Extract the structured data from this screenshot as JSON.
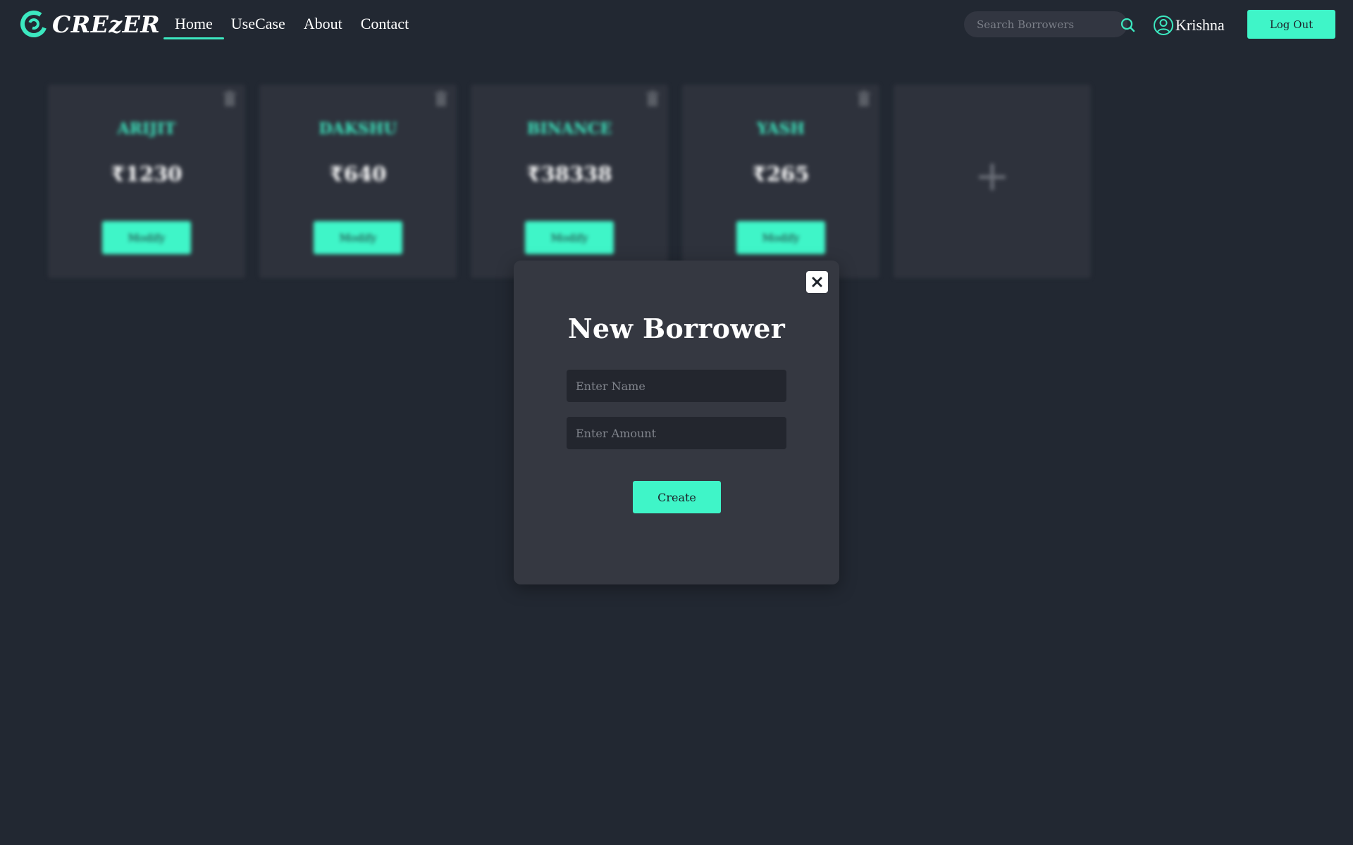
{
  "brand": {
    "name": "CREzER",
    "logo_icon": "crezer-logo-icon",
    "accent_color": "#3ff5c8"
  },
  "nav": {
    "links": [
      {
        "label": "Home",
        "active": true
      },
      {
        "label": "UseCase",
        "active": false
      },
      {
        "label": "About",
        "active": false
      },
      {
        "label": "Contact",
        "active": false
      }
    ]
  },
  "search": {
    "placeholder": "Search Borrowers",
    "value": "",
    "icon": "search-icon"
  },
  "user": {
    "name": "Krishna",
    "icon": "user-circle-icon"
  },
  "logout": {
    "label": "Log Out"
  },
  "borrowers": [
    {
      "name": "ARIJIT",
      "amount": "₹1230",
      "button": "Modify"
    },
    {
      "name": "DAKSHU",
      "amount": "₹640",
      "button": "Modify"
    },
    {
      "name": "BINANCE",
      "amount": "₹38338",
      "button": "Modify"
    },
    {
      "name": "YASH",
      "amount": "₹265",
      "button": "Modify"
    }
  ],
  "add_card": {
    "symbol": "+"
  },
  "modal": {
    "title": "New Borrower",
    "name_placeholder": "Enter Name",
    "amount_placeholder": "Enter Amount",
    "submit_label": "Create",
    "close_icon": "close-icon"
  }
}
